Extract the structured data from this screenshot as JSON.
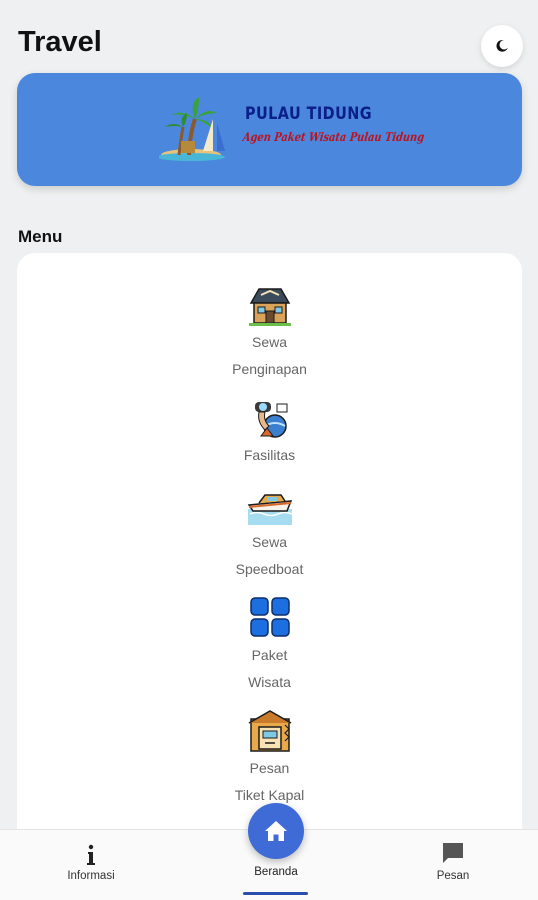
{
  "header": {
    "title": "Travel",
    "theme_toggle_icon": "moon-icon"
  },
  "banner": {
    "title": "PULAU TIDUNG",
    "subtitle": "Agen Paket Wisata Pulau Tidung",
    "background": "#4a87dd"
  },
  "menu": {
    "title": "Menu",
    "items": [
      {
        "icon": "house-icon",
        "line1": "Sewa",
        "line2": "Penginapan"
      },
      {
        "icon": "diving-icon",
        "line1": "Fasilitas",
        "line2": ""
      },
      {
        "icon": "speedboat-icon",
        "line1": "Sewa",
        "line2": "Speedboat"
      },
      {
        "icon": "grid-icon",
        "line1": "Paket",
        "line2": "Wisata"
      },
      {
        "icon": "ticket-icon",
        "line1": "Pesan",
        "line2": "Tiket Kapal"
      }
    ]
  },
  "bottom_nav": {
    "info_label": "Informasi",
    "home_label": "Beranda",
    "message_label": "Pesan",
    "accent": "#3f6bd7"
  }
}
